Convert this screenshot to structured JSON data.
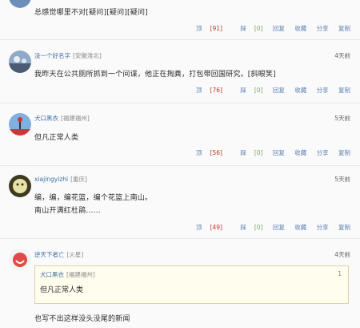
{
  "comments": [
    {
      "text": "总感觉哪里不对[疑问][疑问][疑问]",
      "actions": {
        "up_label": "顶",
        "up_count": "[91]",
        "down_label": "踩",
        "down_count": "[0]",
        "reply": "回复",
        "fav": "收藏",
        "share": "分享",
        "copy": "复制"
      }
    },
    {
      "user": "没一个好名字",
      "location": "[安徽淮北]",
      "time": "4天前",
      "text": "我昨天在公共厕所抓到一个间谍，他正在掏粪，打包带回国研究。[斜眼笑]",
      "actions": {
        "up_label": "顶",
        "up_count": "[76]",
        "down_label": "踩",
        "down_count": "[0]",
        "reply": "回复",
        "fav": "收藏",
        "share": "分享",
        "copy": "复制"
      }
    },
    {
      "user": "犬口黑衣",
      "location": "[福建福州]",
      "time": "5天前",
      "text": "但凡正常人类",
      "actions": {
        "up_label": "顶",
        "up_count": "[56]",
        "down_label": "踩",
        "down_count": "[0]",
        "reply": "回复",
        "fav": "收藏",
        "share": "分享",
        "copy": "复制"
      }
    },
    {
      "user": "xiajingyizhi",
      "location": "[重庆]",
      "time": "5天前",
      "text_line1": "编，编，编花篮，编个花篮上南山。",
      "text_line2": "南山开满红杜鹃……",
      "actions": {
        "up_label": "顶",
        "up_count": "[49]",
        "down_label": "踩",
        "down_count": "[0]",
        "reply": "回复",
        "fav": "收藏",
        "share": "分享",
        "copy": "复制"
      }
    },
    {
      "user": "逆天下者亡",
      "location": "[火星]",
      "time": "4天前",
      "quote": {
        "user": "犬口黑衣",
        "location": "[福建福州]",
        "index": "1",
        "text": "但凡正常人类"
      },
      "text": "也写不出这样没头没尾的新闻"
    }
  ]
}
